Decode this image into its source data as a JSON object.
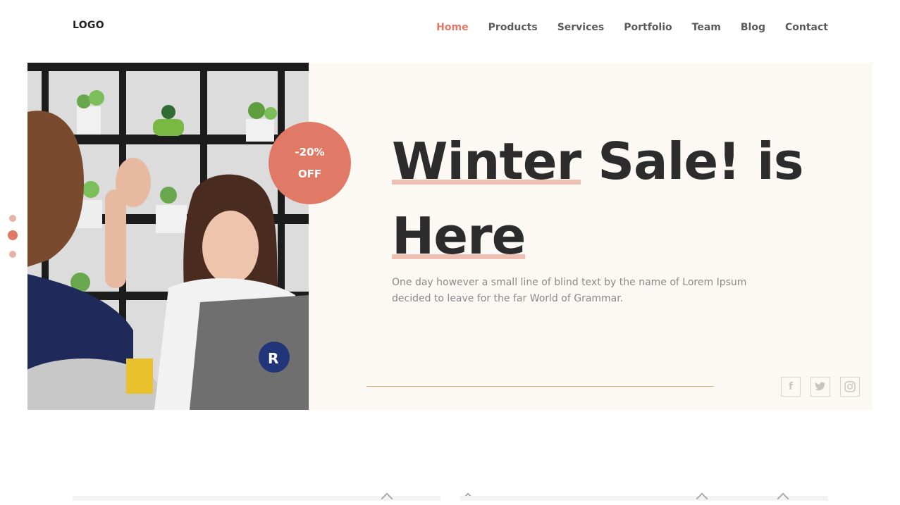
{
  "header": {
    "logo": "LOGO",
    "nav": [
      "Home",
      "Products",
      "Services",
      "Portfolio",
      "Team",
      "Blog",
      "Contact"
    ],
    "active_nav": "Home"
  },
  "hero": {
    "badge": {
      "line1": "-20%",
      "line2": "OFF"
    },
    "title": {
      "word1": "Winter",
      "word2": "Sale! is",
      "word3": "Here"
    },
    "description": "One day however a small line of blind text by the name of Lorem Ipsum decided to leave for the far World of Grammar.",
    "social_icons": [
      "facebook-icon",
      "twitter-icon",
      "instagram-icon"
    ],
    "slider_dots": {
      "count": 3,
      "active_index": 1
    }
  },
  "colors": {
    "accent": "#e07a66",
    "hero_bg": "#fcf8f4",
    "title": "#2c2c2c",
    "rule": "#d9a876"
  }
}
